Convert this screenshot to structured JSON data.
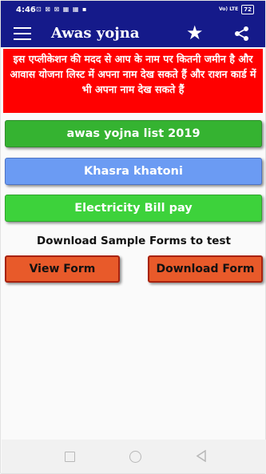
{
  "status_bar": {
    "time": "4:46",
    "icons_text": "⊡ ⊠ ⊠ ▦ ▦ ▪",
    "volte": "Vo) LTE",
    "battery": "72"
  },
  "app_bar": {
    "title": "Awas yojna",
    "menu_icon": "hamburger-menu-icon",
    "star_icon": "star-icon",
    "share_icon": "share-icon"
  },
  "banner": {
    "text": "इस एप्लीकेशन की मदद से आप के नाम पर कितनी जमीन है और आवास योजना लिस्ट में अपना नाम देख सकते हैं और राशन कार्ड में भी अपना नाम देख सकते हैं",
    "background": "#ff0000"
  },
  "buttons": {
    "awas_list": "awas yojna list 2019",
    "khasra": "Khasra khatoni",
    "electricity": "Electricity Bill pay"
  },
  "download": {
    "heading": "Download Sample Forms to test",
    "view_form": "View Form",
    "download_form": "Download Form"
  },
  "colors": {
    "app_bar": "#151a8a",
    "green_button": "#35b331",
    "blue_button": "#6b9bf3",
    "orange_button": "#e85a2a"
  }
}
